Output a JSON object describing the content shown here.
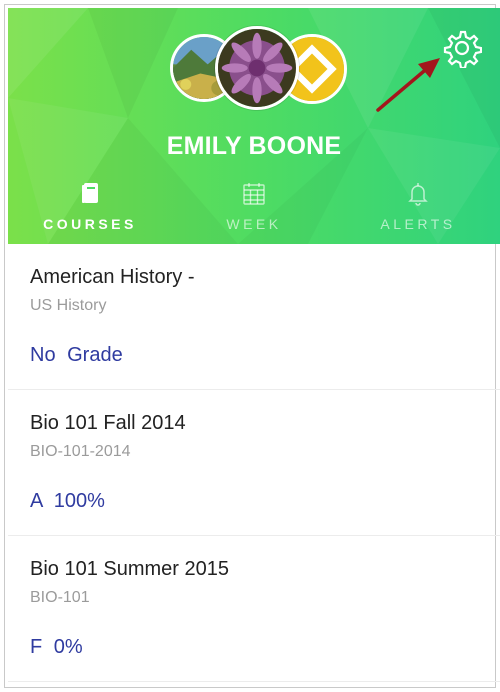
{
  "profile": {
    "name": "EMILY BOONE"
  },
  "tabs": [
    {
      "label": "COURSES",
      "icon": "book-icon",
      "active": true
    },
    {
      "label": "WEEK",
      "icon": "calendar-icon",
      "active": false
    },
    {
      "label": "ALERTS",
      "icon": "bell-icon",
      "active": false
    }
  ],
  "courses": [
    {
      "title": "American History -",
      "code": "US History",
      "grade": "No Grade"
    },
    {
      "title": "Bio 101 Fall 2014",
      "code": "BIO-101-2014",
      "grade": "A  100%"
    },
    {
      "title": "Bio 101 Summer 2015",
      "code": "BIO-101",
      "grade": "F  0%"
    }
  ],
  "colors": {
    "header_start": "#7be04a",
    "header_end": "#2fd27e",
    "grade_text": "#2f3ba0",
    "annotation_arrow": "#a3161c"
  }
}
